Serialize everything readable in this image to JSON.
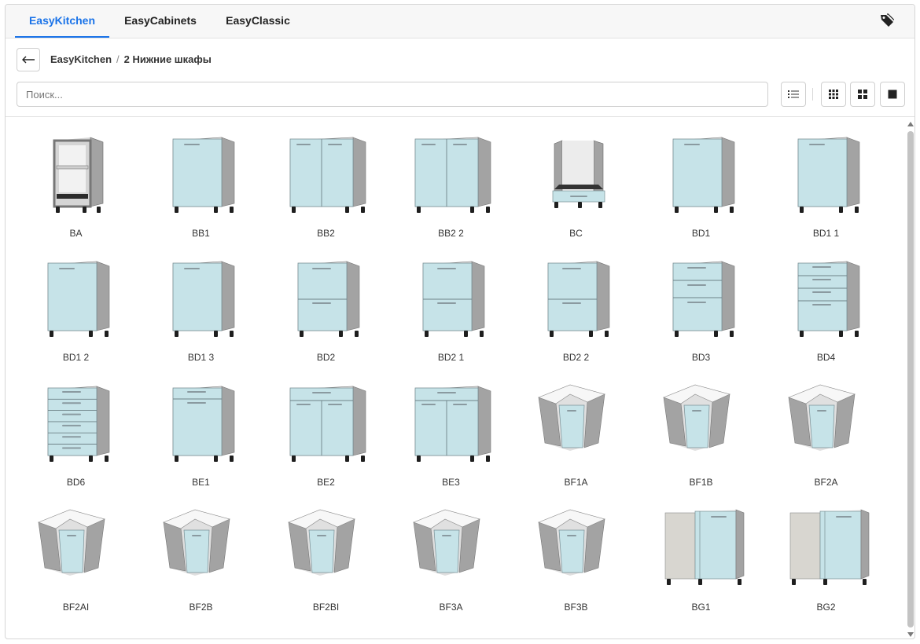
{
  "tabs": [
    {
      "label": "EasyKitchen",
      "active": true
    },
    {
      "label": "EasyCabinets",
      "active": false
    },
    {
      "label": "EasyClassic",
      "active": false
    }
  ],
  "breadcrumb": {
    "root": "EasyKitchen",
    "separator": "/",
    "current": "2 Нижние шкафы"
  },
  "search": {
    "placeholder": "Поиск...",
    "value": ""
  },
  "view_buttons": [
    "list-view",
    "small-grid-view",
    "medium-grid-view",
    "large-grid-view"
  ],
  "colors": {
    "accent": "#1a73e8",
    "door": "#c6e3e8",
    "carcass": "#a3a3a3"
  },
  "items": [
    {
      "label": "BA",
      "kind": "open"
    },
    {
      "label": "BB1",
      "kind": "door1"
    },
    {
      "label": "BB2",
      "kind": "door2"
    },
    {
      "label": "BB2 2",
      "kind": "door2"
    },
    {
      "label": "BC",
      "kind": "oven"
    },
    {
      "label": "BD1",
      "kind": "door1"
    },
    {
      "label": "BD1 1",
      "kind": "door1"
    },
    {
      "label": "BD1 2",
      "kind": "door1"
    },
    {
      "label": "BD1 3",
      "kind": "door1"
    },
    {
      "label": "BD2",
      "kind": "drawers2"
    },
    {
      "label": "BD2 1",
      "kind": "drawers2"
    },
    {
      "label": "BD2 2",
      "kind": "drawers2"
    },
    {
      "label": "BD3",
      "kind": "drawers3"
    },
    {
      "label": "BD4",
      "kind": "drawers4"
    },
    {
      "label": "BD6",
      "kind": "drawers6"
    },
    {
      "label": "BE1",
      "kind": "drawerdoor1"
    },
    {
      "label": "BE2",
      "kind": "drawerdoor2"
    },
    {
      "label": "BE3",
      "kind": "drawerdoor2"
    },
    {
      "label": "BF1A",
      "kind": "corner"
    },
    {
      "label": "BF1B",
      "kind": "corner"
    },
    {
      "label": "BF2A",
      "kind": "corner"
    },
    {
      "label": "BF2AI",
      "kind": "corner"
    },
    {
      "label": "BF2B",
      "kind": "corner"
    },
    {
      "label": "BF2BI",
      "kind": "corner"
    },
    {
      "label": "BF3A",
      "kind": "corner"
    },
    {
      "label": "BF3B",
      "kind": "corner"
    },
    {
      "label": "BG1",
      "kind": "blind"
    },
    {
      "label": "BG2",
      "kind": "blind"
    }
  ]
}
